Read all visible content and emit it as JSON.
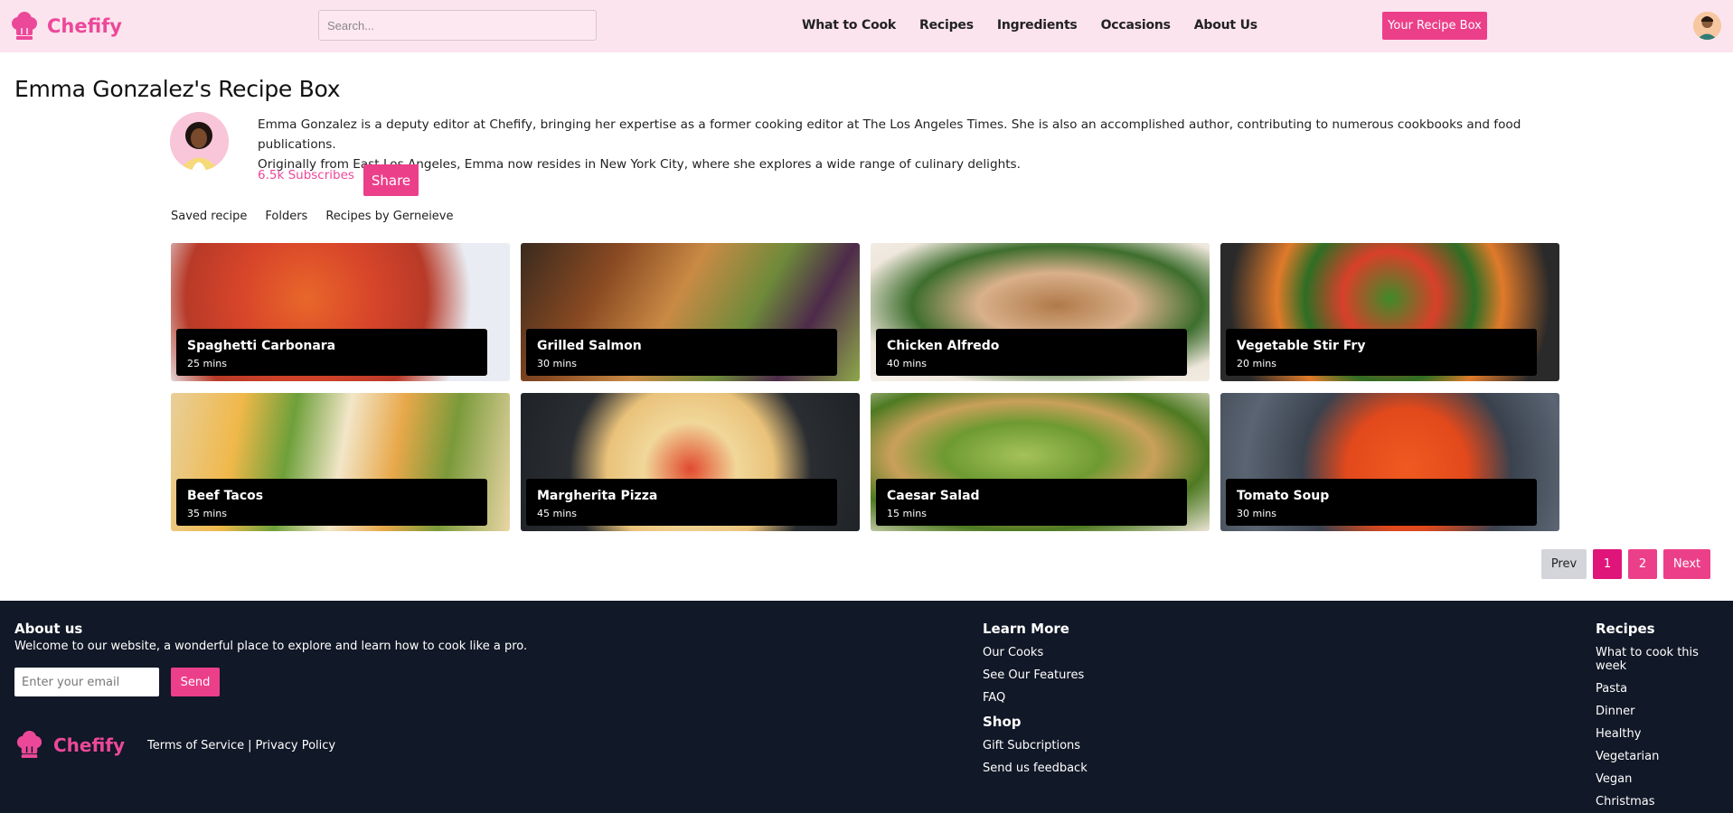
{
  "header": {
    "logo_text": "Chefify",
    "search_placeholder": "Search...",
    "nav": [
      "What to Cook",
      "Recipes",
      "Ingredients",
      "Occasions",
      "About Us"
    ],
    "recipe_box_label": "Your Recipe Box"
  },
  "profile": {
    "title": "Emma Gonzalez's Recipe Box",
    "bio_line1": "Emma Gonzalez is a deputy editor at Chefify, bringing her expertise as a former cooking editor at The Los Angeles Times. She is also an accomplished author, contributing to numerous cookbooks and food publications.",
    "bio_line2": "Originally from East Los Angeles, Emma now resides in New York City, where she explores a wide range of culinary delights.",
    "subscribes": "6.5k Subscribes",
    "share_label": "Share"
  },
  "tabs": [
    "Saved recipe",
    "Folders",
    "Recipes by Gerneieve"
  ],
  "recipes": [
    {
      "name": "Spaghetti Carbonara",
      "time": "25 mins"
    },
    {
      "name": "Grilled Salmon",
      "time": "30 mins"
    },
    {
      "name": "Chicken Alfredo",
      "time": "40 mins"
    },
    {
      "name": "Vegetable Stir Fry",
      "time": "20 mins"
    },
    {
      "name": "Beef Tacos",
      "time": "35 mins"
    },
    {
      "name": "Margherita Pizza",
      "time": "45 mins"
    },
    {
      "name": "Caesar Salad",
      "time": "15 mins"
    },
    {
      "name": "Tomato Soup",
      "time": "30 mins"
    }
  ],
  "pagination": {
    "prev": "Prev",
    "pages": [
      "1",
      "2"
    ],
    "next": "Next",
    "current": "1"
  },
  "footer": {
    "about_title": "About us",
    "about_text": "Welcome to our website, a wonderful place to explore and learn how to cook like a pro.",
    "email_placeholder": "Enter your email",
    "send_label": "Send",
    "logo_text": "Chefify",
    "terms": "Terms of Service",
    "separator": "|",
    "privacy": "Privacy Policy",
    "learn_more_title": "Learn More",
    "learn_more_links": [
      "Our Cooks",
      "See Our Features",
      "FAQ"
    ],
    "shop_title": "Shop",
    "shop_links": [
      "Gift Subcriptions",
      "Send us feedback"
    ],
    "recipes_title": "Recipes",
    "recipes_links": [
      "What to cook this week",
      "Pasta",
      "Dinner",
      "Healthy",
      "Vegetarian",
      "Vegan",
      "Christmas"
    ]
  },
  "colors": {
    "accent": "#ec3f8a",
    "header_bg": "#fce4ee",
    "footer_bg": "#111827"
  },
  "icons": {
    "logo": "chef-hat-icon"
  }
}
